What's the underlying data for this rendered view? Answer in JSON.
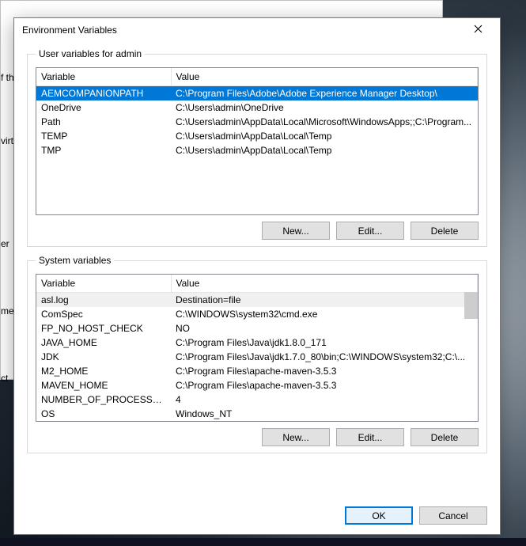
{
  "dialog": {
    "title": "Environment Variables",
    "user_group_label": "User variables for admin",
    "system_group_label": "System variables",
    "columns": {
      "variable": "Variable",
      "value": "Value"
    },
    "buttons": {
      "new": "New...",
      "edit": "Edit...",
      "delete": "Delete",
      "ok": "OK",
      "cancel": "Cancel"
    }
  },
  "user_vars": [
    {
      "name": "AEMCOMPANIONPATH",
      "value": "C:\\Program Files\\Adobe\\Adobe Experience Manager Desktop\\",
      "selected": true
    },
    {
      "name": "OneDrive",
      "value": "C:\\Users\\admin\\OneDrive"
    },
    {
      "name": "Path",
      "value": "C:\\Users\\admin\\AppData\\Local\\Microsoft\\WindowsApps;;C:\\Program..."
    },
    {
      "name": "TEMP",
      "value": "C:\\Users\\admin\\AppData\\Local\\Temp"
    },
    {
      "name": "TMP",
      "value": "C:\\Users\\admin\\AppData\\Local\\Temp"
    }
  ],
  "system_vars": [
    {
      "name": "asl.log",
      "value": "Destination=file",
      "flagged": true
    },
    {
      "name": "ComSpec",
      "value": "C:\\WINDOWS\\system32\\cmd.exe"
    },
    {
      "name": "FP_NO_HOST_CHECK",
      "value": "NO"
    },
    {
      "name": "JAVA_HOME",
      "value": "C:\\Program Files\\Java\\jdk1.8.0_171"
    },
    {
      "name": "JDK",
      "value": "C:\\Program Files\\Java\\jdk1.7.0_80\\bin;C:\\WINDOWS\\system32;C:\\..."
    },
    {
      "name": "M2_HOME",
      "value": "C:\\Program Files\\apache-maven-3.5.3"
    },
    {
      "name": "MAVEN_HOME",
      "value": "C:\\Program Files\\apache-maven-3.5.3"
    },
    {
      "name": "NUMBER_OF_PROCESSORS",
      "value": "4"
    },
    {
      "name": "OS",
      "value": "Windows_NT"
    }
  ],
  "background": {
    "labels": [
      "f th",
      "virt",
      "er",
      "men",
      "ct"
    ]
  }
}
